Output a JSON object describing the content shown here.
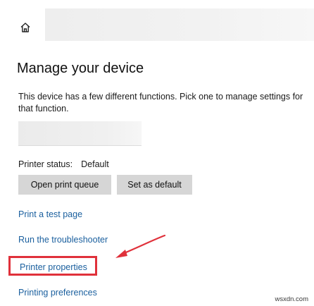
{
  "header": {
    "home_icon": "home-icon"
  },
  "page": {
    "title": "Manage your device",
    "description": "This device has a few different functions. Pick one to manage settings for that function."
  },
  "status": {
    "label": "Printer status:",
    "value": "Default"
  },
  "buttons": {
    "open_queue": "Open print queue",
    "set_default": "Set as default"
  },
  "links": {
    "test_page": "Print a test page",
    "troubleshooter": "Run the troubleshooter",
    "properties": "Printer properties",
    "preferences": "Printing preferences"
  },
  "annotation": {
    "highlight_color": "#e0313b",
    "arrow_color": "#e0313b"
  },
  "colors": {
    "link": "#1a5f9e",
    "button_bg": "#d6d6d6"
  },
  "watermark": "wsxdn.com"
}
